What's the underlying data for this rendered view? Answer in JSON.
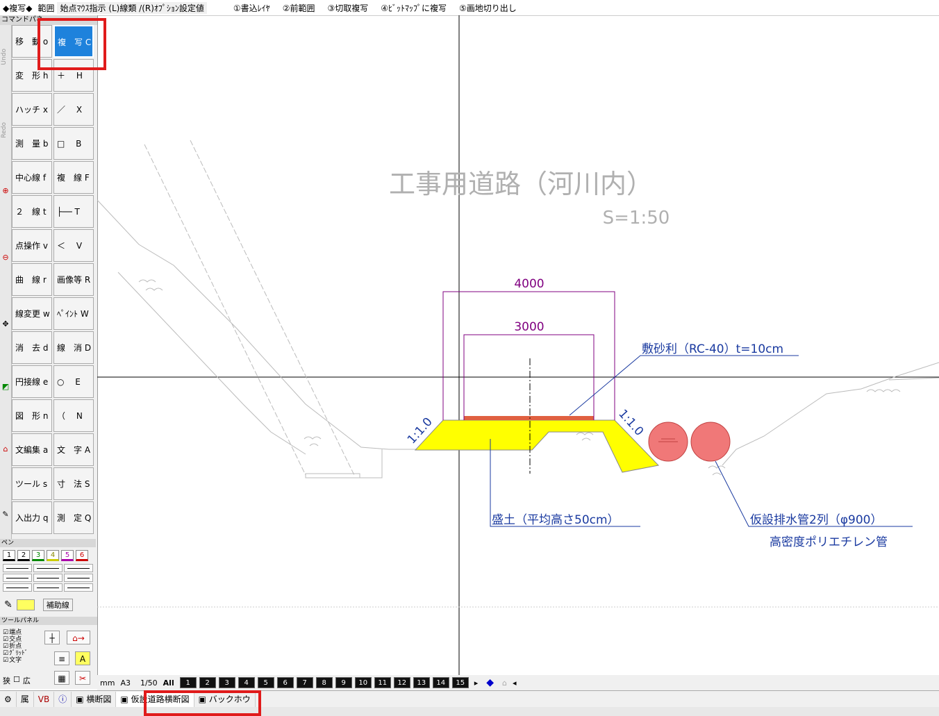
{
  "topbar": {
    "mode": "◆複写◆",
    "range": "範囲",
    "hint": "始点ﾏｳｽ指示 (L)線類 /(R)ｵﾌﾟｼｮﾝ設定値",
    "options": [
      "①書込ﾚｲﾔ",
      "②前範囲",
      "③切取複写",
      "④ﾋﾞｯﾄﾏｯﾌﾟに複写",
      "⑤画地切り出し"
    ]
  },
  "command_panel": {
    "title": "コマンドパネ",
    "undo": "Undo",
    "redo": "Redo",
    "left": [
      "移　動 o",
      "変　形 h",
      "ハッチ x",
      "測　量 b",
      "中心線 f",
      "２　線 t",
      "点操作 v",
      "曲　線 r",
      "線変更 w",
      "消　去 d",
      "円接線 e",
      "図　形 n",
      "文編集 a",
      "ツール s",
      "入出力 q"
    ],
    "right": [
      "複　写 C",
      "＋　 H",
      "／　 X",
      "□　 B",
      "複　線 F",
      "├── T",
      "＜　 V",
      "画像等 R",
      "ﾍﾟｲﾝﾄ W",
      "線　消 D",
      "○　 E",
      "（　 N",
      "文　字 A",
      "寸　法 S",
      "測　定 Q"
    ]
  },
  "pen": {
    "title": "ペン",
    "colors": [
      "1",
      "2",
      "3",
      "4",
      "5",
      "6"
    ],
    "aux_label": "補助線"
  },
  "tool_panel": {
    "title": "ツールパネル",
    "snaps": [
      "端点",
      "交点",
      "折点",
      "ｸﾞﾘｯﾄﾞ",
      "文字"
    ],
    "narrow": "狭",
    "wide": "広"
  },
  "layers": {
    "unit": "mm",
    "paper": "A3",
    "scale": "1/50",
    "all": "All",
    "items": [
      "1",
      "2",
      "3",
      "4",
      "5",
      "6",
      "7",
      "8",
      "9",
      "10",
      "11",
      "12",
      "13",
      "14",
      "15"
    ]
  },
  "bottom_tabs": [
    "属",
    "横断図",
    "仮設道路横断図",
    "バックホウ"
  ],
  "drawing": {
    "title": "工事用道路（河川内）",
    "scale": "S=1:50",
    "dim_outer": "4000",
    "dim_inner": "3000",
    "slope_left": "1:1.0",
    "slope_right": "1:1.0",
    "gravel_note": "敷砂利（RC-40）t=10cm",
    "fill_note": "盛土（平均高さ50cm）",
    "pipe_note": "仮設排水管2列（φ900）",
    "pipe_sub": "高密度ポリエチレン管",
    "colors": {
      "fill": "#ffff00",
      "gravel": "#e06040",
      "pipe": "#f07878",
      "dim": "#800080",
      "note": "#1a3aa0",
      "title": "#b0b0b0"
    }
  }
}
